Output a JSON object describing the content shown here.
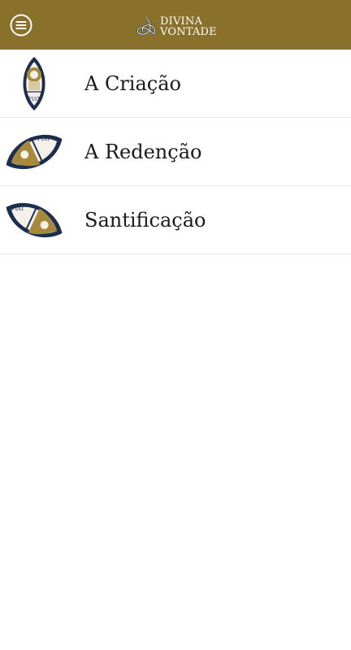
{
  "header": {
    "brand_line1": "DIVINA",
    "brand_line2": "VONTADE",
    "menu_icon": "hamburger-menu-icon",
    "colors": {
      "bar": "#8a712b",
      "icon": "#ffffff"
    }
  },
  "list": {
    "items": [
      {
        "label": "A Criação",
        "icon": "creation-emblem-icon",
        "emblem_text": "FIAT"
      },
      {
        "label": "A Redenção",
        "icon": "redemption-emblem-icon",
        "emblem_text": "FIAT"
      },
      {
        "label": "Santificação",
        "icon": "sanctification-emblem-icon",
        "emblem_text": "FIAT"
      }
    ]
  },
  "colors": {
    "navy": "#1c2e4e",
    "gold": "#a7893d",
    "divider": "#e6e6e6"
  }
}
